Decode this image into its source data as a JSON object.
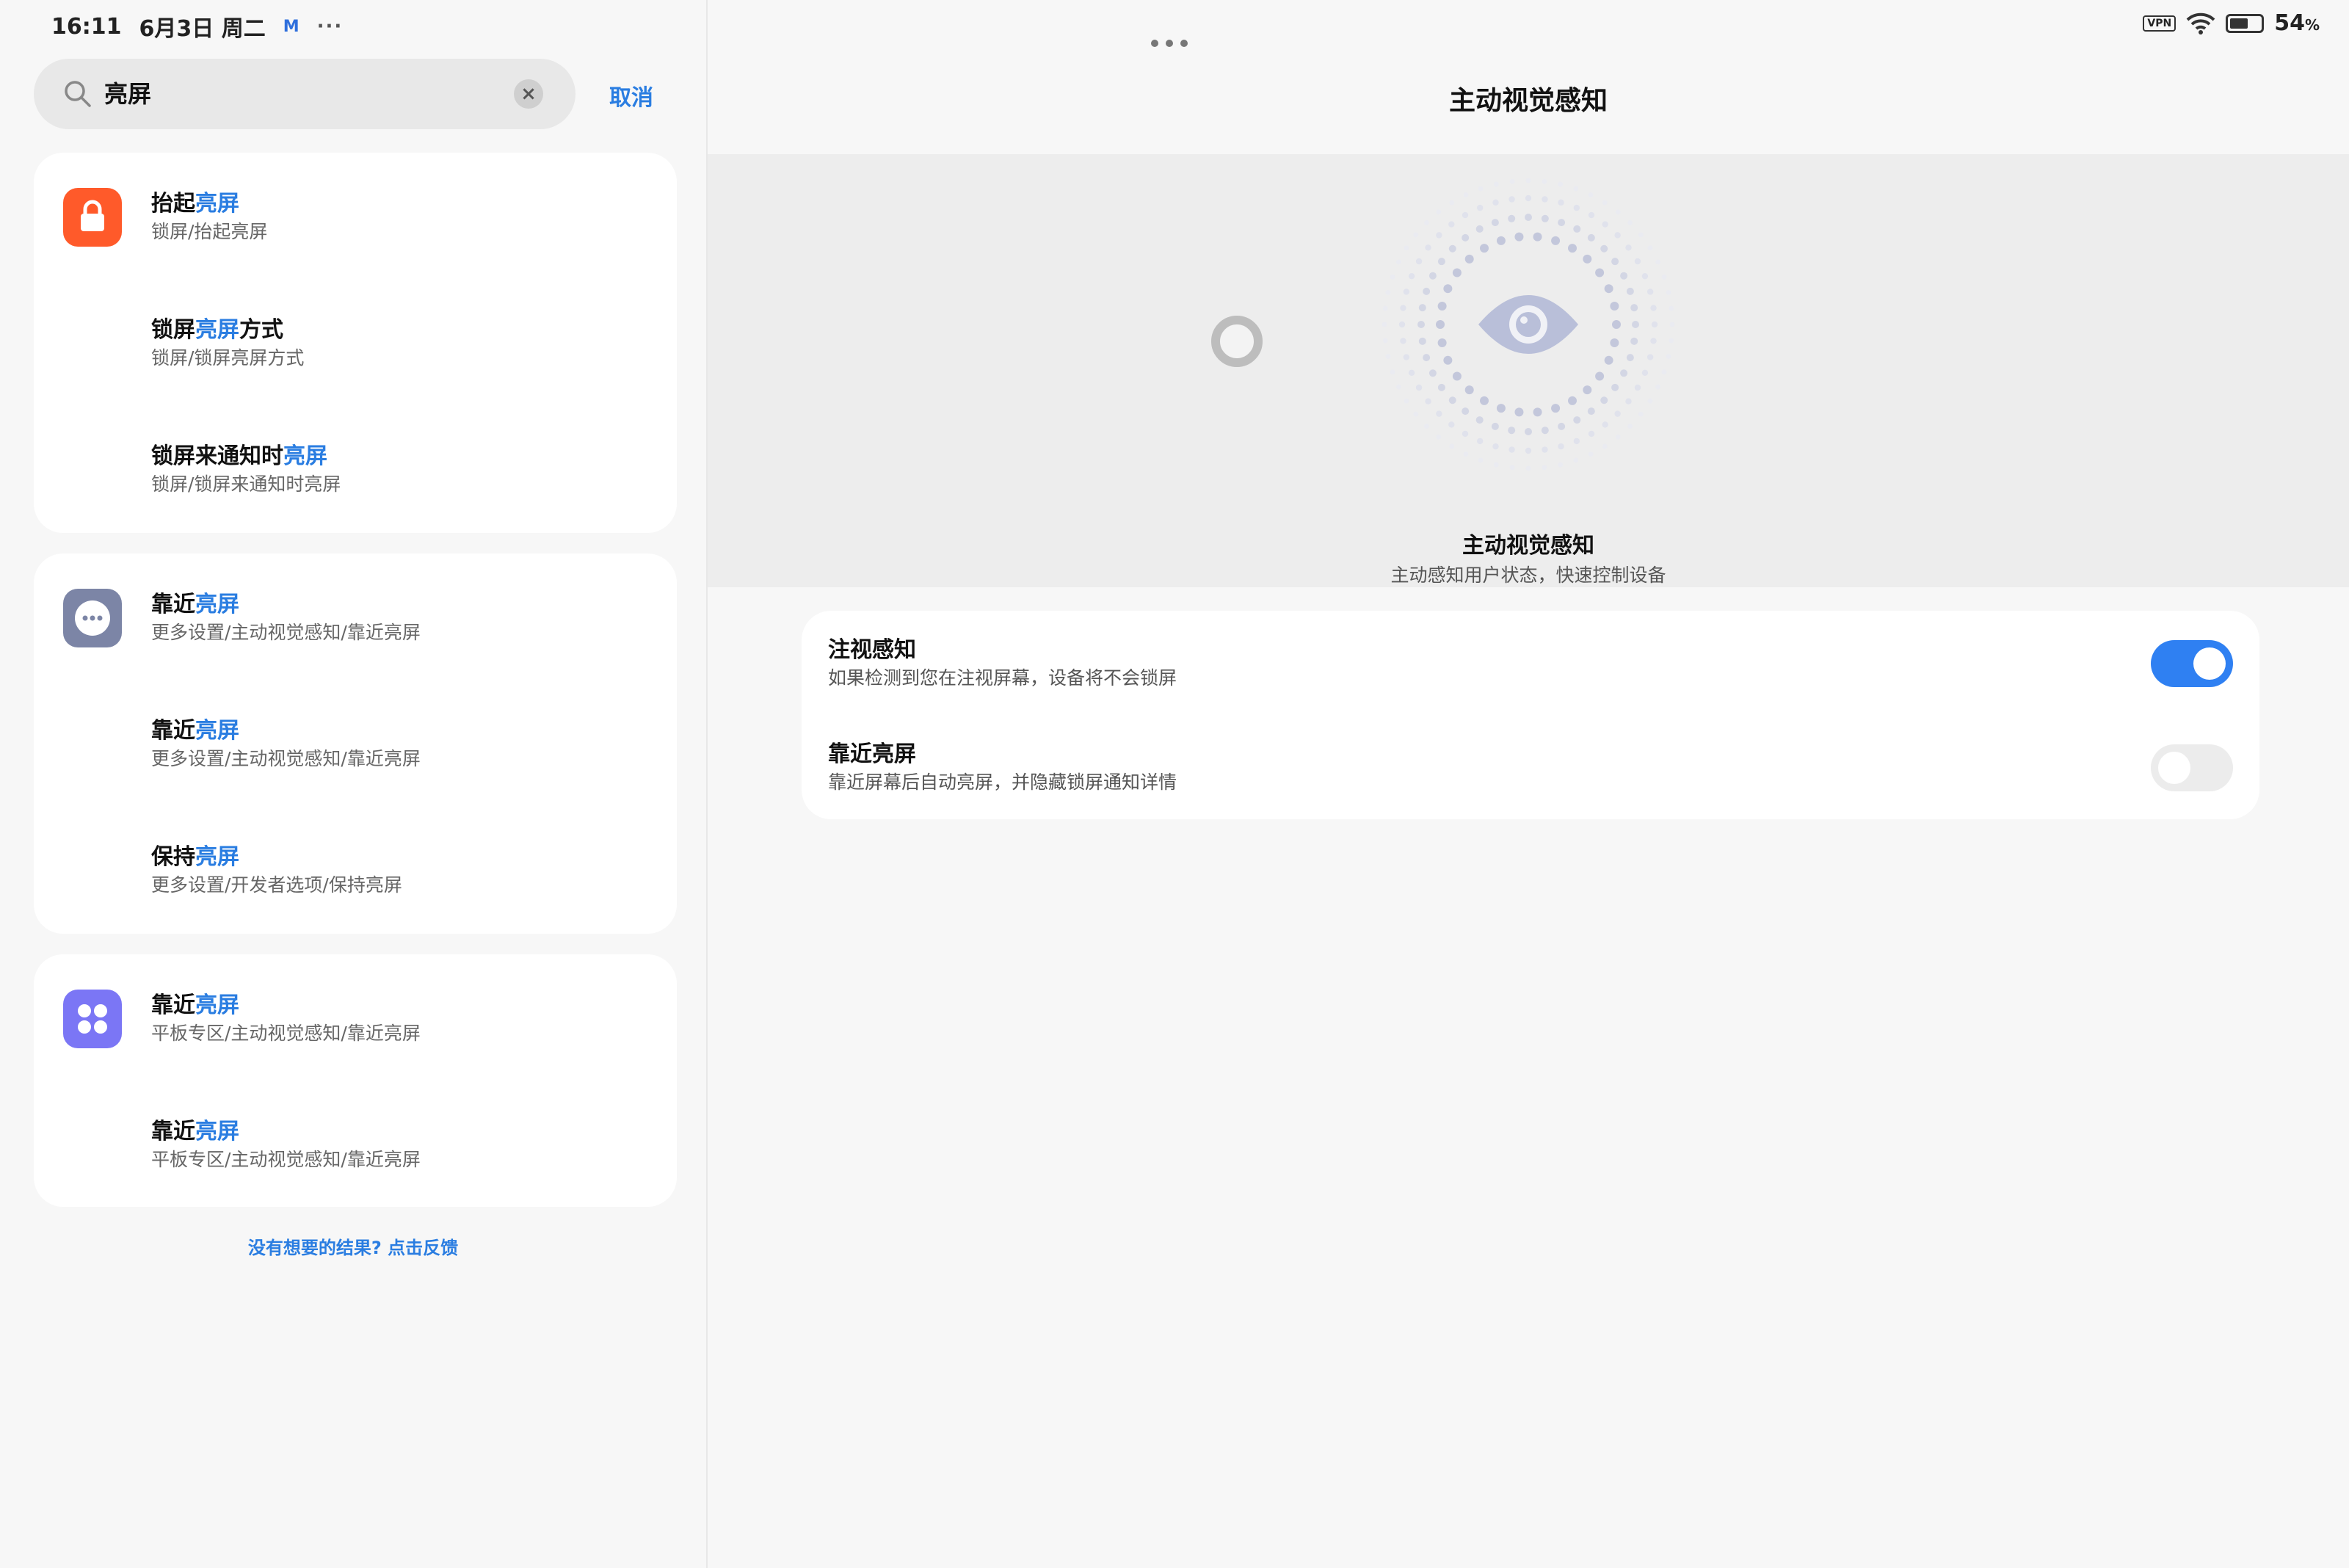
{
  "status_bar": {
    "time": "16:11",
    "date": "6月3日 周二",
    "mail_icon": "M",
    "more": "···",
    "vpn": "VPN",
    "battery": "54",
    "battery_unit": "%"
  },
  "search": {
    "query": "亮屏",
    "cancel_label": "取消"
  },
  "results": {
    "group1": {
      "icon": "lock-icon",
      "items": [
        {
          "pre": "抬起",
          "hl": "亮屏",
          "post": "",
          "path": "锁屏/抬起亮屏"
        },
        {
          "pre": "锁屏",
          "hl": "亮屏",
          "post": "方式",
          "path": "锁屏/锁屏亮屏方式"
        },
        {
          "pre": "锁屏来通知时",
          "hl": "亮屏",
          "post": "",
          "path": "锁屏/锁屏来通知时亮屏"
        }
      ]
    },
    "group2": {
      "icon": "more-settings-icon",
      "items": [
        {
          "pre": "靠近",
          "hl": "亮屏",
          "post": "",
          "path": "更多设置/主动视觉感知/靠近亮屏"
        },
        {
          "pre": "靠近",
          "hl": "亮屏",
          "post": "",
          "path": "更多设置/主动视觉感知/靠近亮屏"
        },
        {
          "pre": "保持",
          "hl": "亮屏",
          "post": "",
          "path": "更多设置/开发者选项/保持亮屏"
        }
      ]
    },
    "group3": {
      "icon": "tablet-zone-icon",
      "items": [
        {
          "pre": "靠近",
          "hl": "亮屏",
          "post": "",
          "path": "平板专区/主动视觉感知/靠近亮屏"
        },
        {
          "pre": "靠近",
          "hl": "亮屏",
          "post": "",
          "path": "平板专区/主动视觉感知/靠近亮屏"
        }
      ]
    },
    "feedback_label": "没有想要的结果? 点击反馈"
  },
  "detail": {
    "page_title": "主动视觉感知",
    "hero_title": "主动视觉感知",
    "hero_subtitle": "主动感知用户状态，快速控制设备",
    "settings": [
      {
        "title": "注视感知",
        "desc": "如果检测到您在注视屏幕，设备将不会锁屏",
        "enabled": true
      },
      {
        "title": "靠近亮屏",
        "desc": "靠近屏幕后自动亮屏，并隐藏锁屏通知详情",
        "enabled": false
      }
    ]
  },
  "colors": {
    "accent": "#2a7de1",
    "toggle_on": "#2f80f2",
    "lock_icon_bg": "#ff5a2a",
    "more_icon_bg": "#7c85a6",
    "tablet_icon_bg": "#7b76f5"
  }
}
